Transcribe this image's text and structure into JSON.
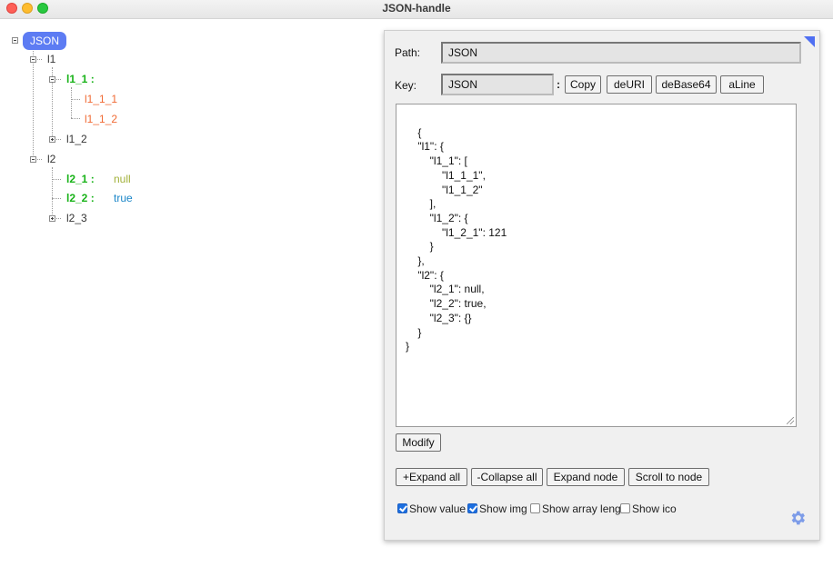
{
  "window": {
    "title": "JSON-handle"
  },
  "tree": {
    "root": "JSON",
    "nodes": {
      "l1": "l1",
      "l1_1": "l1_1 :",
      "l1_1_1": "l1_1_1",
      "l1_1_2": "l1_1_2",
      "l1_2": "l1_2",
      "l2": "l2",
      "l2_1": "l2_1 :",
      "l2_1_value": "null",
      "l2_2": "l2_2 :",
      "l2_2_value": "true",
      "l2_3": "l2_3"
    }
  },
  "panel": {
    "path_label": "Path:",
    "path_value": "JSON",
    "key_label": "Key:",
    "key_value": "JSON",
    "key_separator": ":",
    "buttons": {
      "copy": "Copy",
      "deuri": "deURI",
      "debase64": "deBase64",
      "aline": "aLine",
      "modify": "Modify",
      "expand_all": "+Expand all",
      "collapse_all": "-Collapse all",
      "expand_node": "Expand node",
      "scroll_to_node": "Scroll to node"
    },
    "editor_text": "{\n    \"l1\": {\n        \"l1_1\": [\n            \"l1_1_1\",\n            \"l1_1_2\"\n        ],\n        \"l1_2\": {\n            \"l1_2_1\": 121\n        }\n    },\n    \"l2\": {\n        \"l2_1\": null,\n        \"l2_2\": true,\n        \"l2_3\": {}\n    }\n}",
    "options": [
      {
        "label": "Show value",
        "checked": true
      },
      {
        "label": "Show img",
        "checked": true
      },
      {
        "label": "Show array leng",
        "checked": false
      },
      {
        "label": "Show ico",
        "checked": false
      }
    ]
  },
  "colors": {
    "accent": "#5d7cf3",
    "key_green": "#19b319",
    "array_item": "#f06a34",
    "null_value": "#a2b13a",
    "true_value": "#1a86c8"
  }
}
